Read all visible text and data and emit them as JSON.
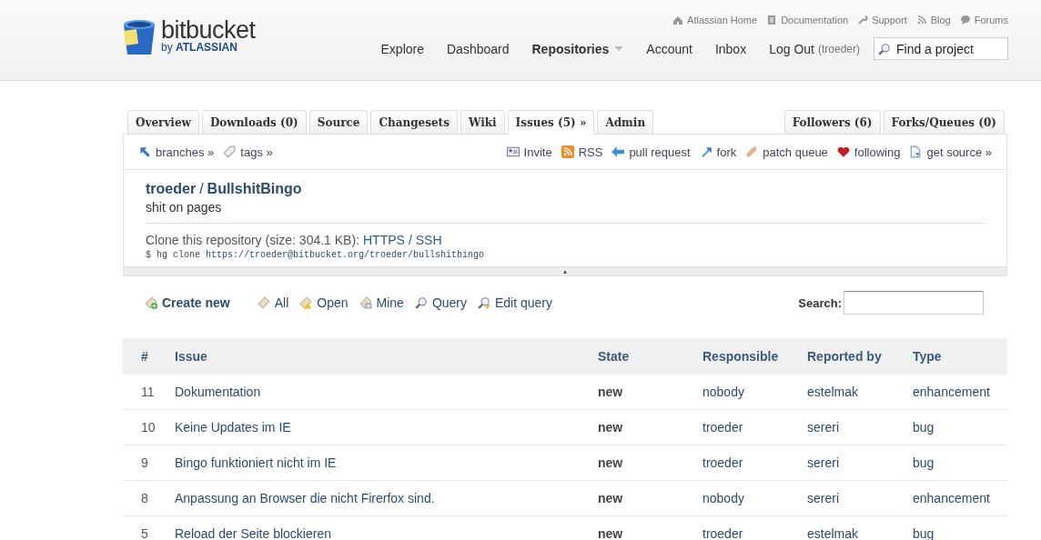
{
  "header": {
    "logo": {
      "name": "bitbucket",
      "byline": "by",
      "brand": "ATLASSIAN"
    },
    "top_links": [
      {
        "label": "Atlassian Home",
        "kind": "home"
      },
      {
        "label": "Documentation",
        "kind": "doc"
      },
      {
        "label": "Support",
        "kind": "wrench"
      },
      {
        "label": "Blog",
        "kind": "feed"
      },
      {
        "label": "Forums",
        "kind": "bubble"
      }
    ],
    "nav": [
      {
        "label": "Explore",
        "selected": false,
        "menu": false
      },
      {
        "label": "Dashboard",
        "selected": false,
        "menu": false
      },
      {
        "label": "Repositories",
        "selected": true,
        "menu": true
      },
      {
        "label": "Account",
        "selected": false,
        "menu": false
      },
      {
        "label": "Inbox",
        "selected": false,
        "menu": false
      },
      {
        "label": "Log Out",
        "note": "(troeder)",
        "selected": false,
        "menu": false
      }
    ],
    "search": {
      "placeholder": "Find a project"
    }
  },
  "tabs": [
    {
      "label": "Overview",
      "selected": false
    },
    {
      "label": "Downloads (0)",
      "selected": false
    },
    {
      "label": "Source",
      "selected": false
    },
    {
      "label": "Changesets",
      "selected": false
    },
    {
      "label": "Wiki",
      "selected": false
    },
    {
      "label": "Issues (5) »",
      "selected": true
    },
    {
      "label": "Admin",
      "selected": false
    }
  ],
  "right_tabs": [
    {
      "label": "Followers (6)",
      "selected": false
    },
    {
      "label": "Forks/Queues (0)",
      "selected": false
    }
  ],
  "toolbar_left": [
    {
      "label": "branches »",
      "kind": "branch"
    },
    {
      "label": "tags »",
      "kind": "tag"
    }
  ],
  "toolbar_right": [
    {
      "label": "Invite",
      "kind": "card"
    },
    {
      "label": "RSS",
      "kind": "rss"
    },
    {
      "label": "pull request",
      "kind": "left"
    },
    {
      "label": "fork",
      "kind": "fork"
    },
    {
      "label": "patch queue",
      "kind": "patch"
    },
    {
      "label": "following",
      "kind": "heart"
    },
    {
      "label": "get source »",
      "kind": "page"
    }
  ],
  "repo": {
    "owner": "troeder",
    "separator": "/",
    "name": "BullshitBingo",
    "description": "shit on pages",
    "clone_label": "Clone this repository (size: 304.1 KB):",
    "protocols": [
      "HTTPS",
      "SSH"
    ],
    "protocol_separator": "/",
    "command": "$ hg clone",
    "url": "https://troeder@bitbucket.org/troeder/bullshitbingo",
    "collapse": "▴"
  },
  "actions": [
    {
      "label": "Create new",
      "kind": "create",
      "primary": true
    },
    {
      "label": "All",
      "kind": "all",
      "primary": false
    },
    {
      "label": "Open",
      "kind": "open",
      "primary": false
    },
    {
      "label": "Mine",
      "kind": "mine",
      "primary": false
    },
    {
      "label": "Query",
      "kind": "query",
      "primary": false
    },
    {
      "label": "Edit query",
      "kind": "editquery",
      "primary": false
    }
  ],
  "issue_search": {
    "label": "Search:"
  },
  "table": {
    "columns": [
      "#",
      "Issue",
      "State",
      "Responsible",
      "Reported by",
      "Type"
    ],
    "rows": [
      [
        "11",
        "Dokumentation",
        "new",
        "nobody",
        "estelmak",
        "enhancement"
      ],
      [
        "10",
        "Keine Updates im IE",
        "new",
        "troeder",
        "sereri",
        "bug"
      ],
      [
        "9",
        "Bingo funktioniert nicht im IE",
        "new",
        "troeder",
        "sereri",
        "bug"
      ],
      [
        "8",
        "Anpassung an Browser die nicht Firerfox sind.",
        "new",
        "nobody",
        "sereri",
        "enhancement"
      ],
      [
        "5",
        "Reload der Seite blockieren",
        "new",
        "troeder",
        "estelmak",
        "bug"
      ]
    ]
  }
}
